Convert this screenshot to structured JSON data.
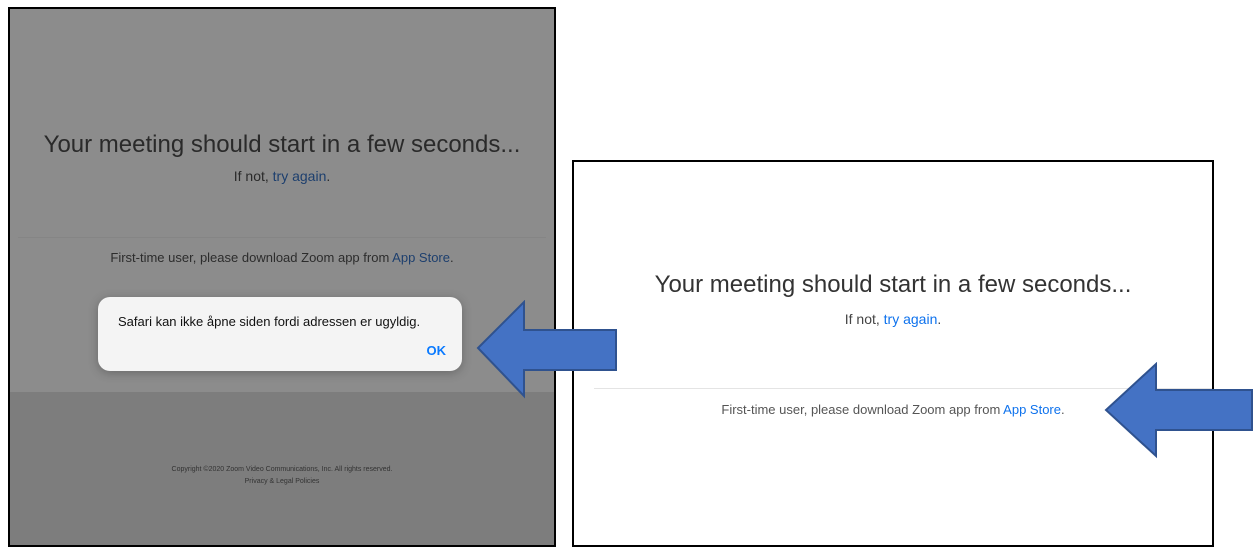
{
  "left_panel": {
    "title": "Your meeting should start in a few seconds...",
    "retry_prefix": "If not, ",
    "retry_link": "try again",
    "retry_suffix": ".",
    "download_prefix": "First-time user, please download Zoom app from ",
    "download_link": "App Store",
    "download_suffix": ".",
    "copyright": "Copyright ©2020 Zoom Video Communications, Inc. All rights reserved.",
    "privacy_link": "Privacy & Legal Policies",
    "alert": {
      "message": "Safari kan ikke åpne siden fordi adressen er ugyldig.",
      "ok_label": "OK"
    }
  },
  "right_panel": {
    "title": "Your meeting should start in a few seconds...",
    "retry_prefix": "If not, ",
    "retry_link": "try again",
    "retry_suffix": ".",
    "download_prefix": "First-time user, please download Zoom app from ",
    "download_link": "App Store",
    "download_suffix": "."
  },
  "colors": {
    "arrow_fill": "#4472c4",
    "arrow_stroke": "#2f528f",
    "link": "#0e72ed",
    "overlay": "#8c8c8c"
  }
}
